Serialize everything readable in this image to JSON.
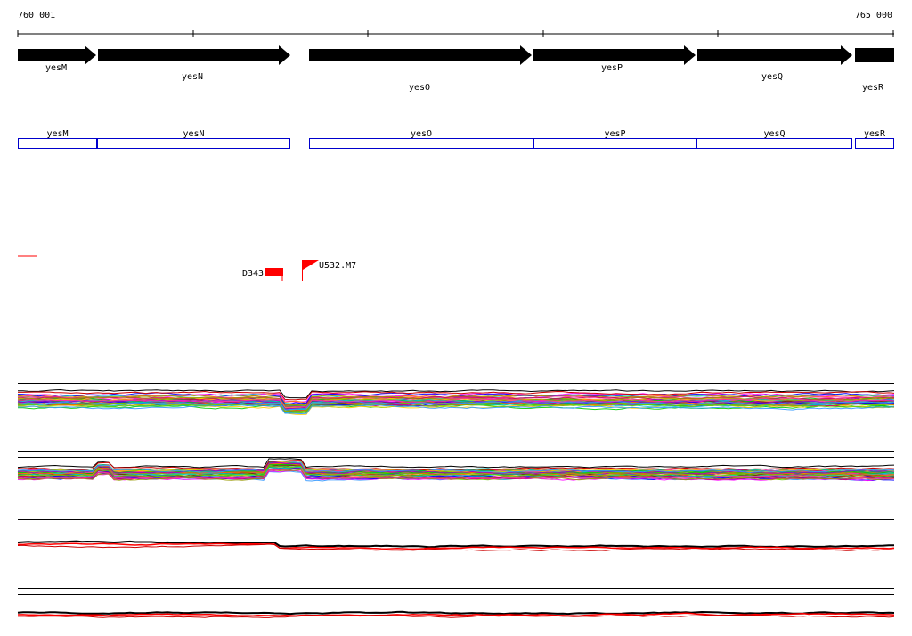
{
  "axis": {
    "start_label": "760 001",
    "end_label": "765 000"
  },
  "genes": [
    {
      "name": "yesM",
      "strand": "+"
    },
    {
      "name": "yesN",
      "strand": "+"
    },
    {
      "name": "yesO",
      "strand": "+"
    },
    {
      "name": "yesP",
      "strand": "+"
    },
    {
      "name": "yesQ",
      "strand": "+"
    },
    {
      "name": "yesR",
      "strand": "+"
    }
  ],
  "transcripts": [
    "yesM",
    "yesN",
    "yesO",
    "yesP",
    "yesQ",
    "yesR"
  ],
  "features": [
    {
      "label": "D343",
      "type": "block",
      "color": "#ff0000"
    },
    {
      "label": "U532.M7",
      "type": "flag",
      "color": "#ff0000"
    }
  ],
  "colors": {
    "gene_arrow": "#000000",
    "transcript_box": "#0000cc",
    "feature": "#ff0000",
    "track_line": "#000000"
  },
  "tracks": [
    {
      "name": "track-1",
      "style": "multicolor"
    },
    {
      "name": "track-2",
      "style": "multicolor"
    },
    {
      "name": "track-3",
      "style": "red-black"
    },
    {
      "name": "track-4",
      "style": "red-black"
    }
  ]
}
